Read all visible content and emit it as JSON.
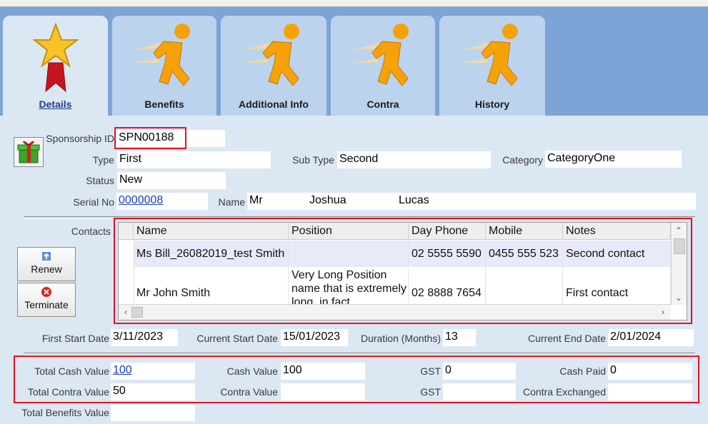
{
  "tabs": [
    {
      "label": "Details",
      "icon": "star-ribbon-icon",
      "active": true
    },
    {
      "label": "Benefits",
      "icon": "running-man-icon"
    },
    {
      "label": "Additional Info",
      "icon": "running-man-icon"
    },
    {
      "label": "Contra",
      "icon": "running-man-icon"
    },
    {
      "label": "History",
      "icon": "running-man-icon"
    }
  ],
  "sponsorship": {
    "id_label": "Sponsorship ID",
    "id_value": "SPN00188",
    "type_label": "Type",
    "type_value": "First",
    "subtype_label": "Sub Type",
    "subtype_value": "Second",
    "category_label": "Category",
    "category_value": "CategoryOne",
    "status_label": "Status",
    "status_value": "New",
    "serial_label": "Serial No",
    "serial_value": "0000008",
    "name_label": "Name",
    "name_title": "Mr",
    "name_first": "Joshua",
    "name_last": "Lucas"
  },
  "contacts": {
    "label": "Contacts",
    "columns": [
      "Name",
      "Position",
      "Day Phone",
      "Mobile",
      "Notes"
    ],
    "rows": [
      {
        "name": "Ms Bill_26082019_test Smith",
        "position": "",
        "day_phone": "02 5555 5590",
        "mobile": "0455 555 523",
        "notes": "Second contact"
      },
      {
        "name": "Mr John Smith",
        "position": "Very Long Position name that is extremely long, in fact",
        "day_phone": "02 8888 7654",
        "mobile": "",
        "notes": "First contact"
      }
    ]
  },
  "buttons": {
    "renew": "Renew",
    "terminate": "Terminate"
  },
  "dates": {
    "first_start_label": "First Start Date",
    "first_start_value": "3/11/2023",
    "current_start_label": "Current Start Date",
    "current_start_value": "15/01/2023",
    "duration_label": "Duration (Months)",
    "duration_value": "13",
    "current_end_label": "Current End Date",
    "current_end_value": "2/01/2024"
  },
  "values": {
    "total_cash_label": "Total Cash Value",
    "total_cash_value": "100",
    "cash_label": "Cash Value",
    "cash_value": "100",
    "gst1_label": "GST",
    "gst1_value": "0",
    "cash_paid_label": "Cash Paid",
    "cash_paid_value": "0",
    "total_contra_label": "Total Contra Value",
    "total_contra_value": "50",
    "contra_label": "Contra Value",
    "contra_value": "",
    "gst2_label": "GST",
    "gst2_value": "",
    "contra_exchanged_label": "Contra Exchanged",
    "contra_exchanged_value": "",
    "total_benefits_label": "Total Benefits Value",
    "total_benefits_value": ""
  },
  "colors": {
    "highlight": "#e0141e",
    "link": "#1a3cc8",
    "tab_bar": "#7da4d6"
  }
}
